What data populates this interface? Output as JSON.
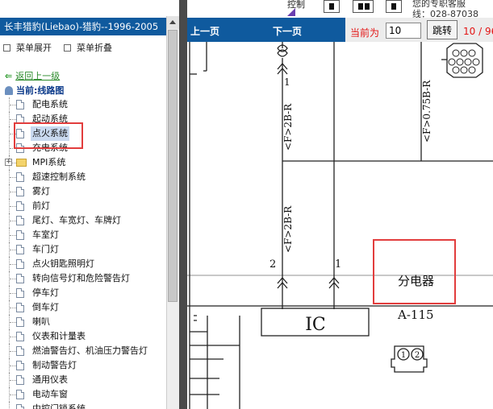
{
  "app": {
    "title": "长丰猎豹(Liebao)-猎豹--1996-2005",
    "expand_label": "菜单展开",
    "collapse_label": "菜单折叠"
  },
  "sidebar": {
    "back_label": "返回上一级",
    "current_label": "当前:线路图",
    "items": [
      {
        "label": "配电系统",
        "type": "doc"
      },
      {
        "label": "起动系统",
        "type": "doc"
      },
      {
        "label": "点火系统",
        "type": "doc",
        "selected": true
      },
      {
        "label": "充电系统",
        "type": "doc"
      },
      {
        "label": "MPI系统",
        "type": "folder"
      },
      {
        "label": "超速控制系统",
        "type": "doc"
      },
      {
        "label": "雾灯",
        "type": "doc"
      },
      {
        "label": "前灯",
        "type": "doc"
      },
      {
        "label": "尾灯、车宽灯、车牌灯",
        "type": "doc"
      },
      {
        "label": "车室灯",
        "type": "doc"
      },
      {
        "label": "车门灯",
        "type": "doc"
      },
      {
        "label": "点火钥匙照明灯",
        "type": "doc"
      },
      {
        "label": "转向信号灯和危险警告灯",
        "type": "doc"
      },
      {
        "label": "停车灯",
        "type": "doc"
      },
      {
        "label": "倒车灯",
        "type": "doc"
      },
      {
        "label": "喇叭",
        "type": "doc"
      },
      {
        "label": "仪表和计量表",
        "type": "doc"
      },
      {
        "label": "燃油警告灯、机油压力警告灯",
        "type": "doc"
      },
      {
        "label": "制动警告灯",
        "type": "doc"
      },
      {
        "label": "通用仪表",
        "type": "doc"
      },
      {
        "label": "电动车窗",
        "type": "doc"
      },
      {
        "label": "中控门锁系统",
        "type": "doc"
      }
    ]
  },
  "toolbar": {
    "top_partial": "控制",
    "phone_top": "您的专职客服",
    "phone_bottom": "线：028-87038",
    "prev_label": "上一页",
    "next_label": "下一页",
    "current_page_label": "当前为",
    "page_value": "10",
    "jump_label": "跳转",
    "page_count": "10 / 96"
  },
  "diagram": {
    "wire_label_1": "<F>0.75B-R",
    "wire_label_2": "<F>2B-R",
    "wire_label_3": "<F>2B-R",
    "pin_1_top": "1",
    "pin_2": "2",
    "pin_1": "1",
    "component_code": "IC",
    "component_name": "分电器",
    "connector_id": "A-115",
    "connector_pin_1": "1",
    "connector_pin_2": "2"
  },
  "colors": {
    "title_blue": "#0f5a9e",
    "highlight_red": "#e23d3d",
    "page_red": "#e31414",
    "link_green": "#2a8a2a"
  }
}
